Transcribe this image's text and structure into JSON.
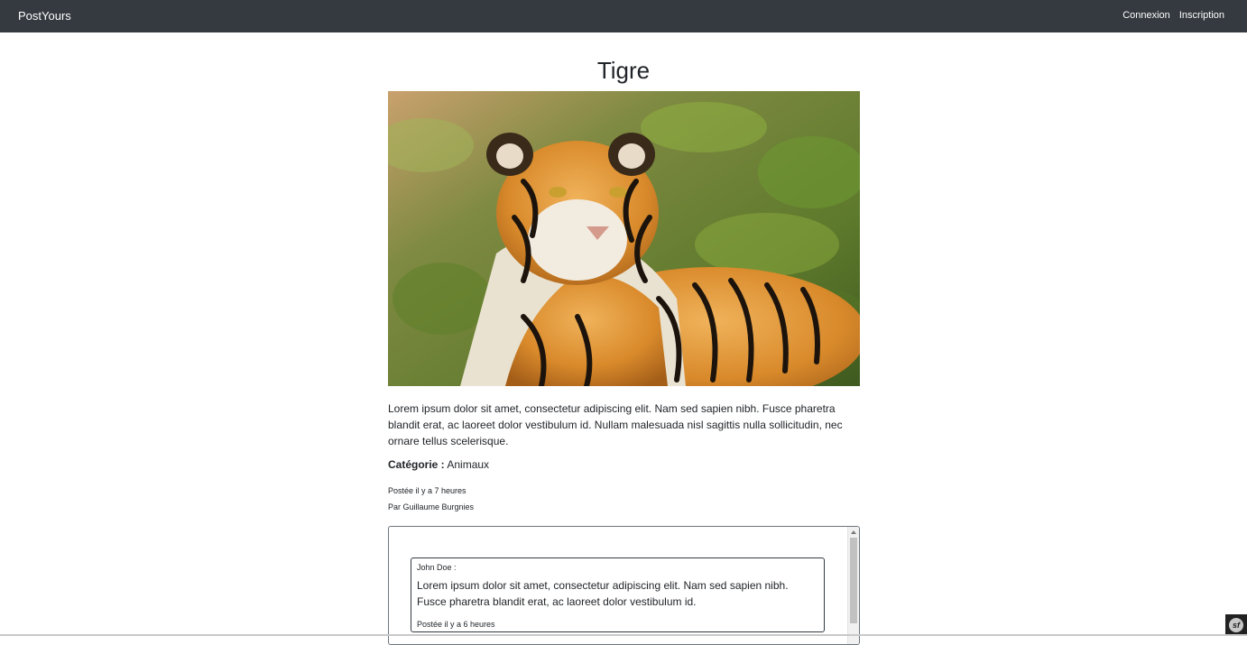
{
  "navbar": {
    "brand": "PostYours",
    "links": [
      "Connexion",
      "Inscription"
    ]
  },
  "post": {
    "title": "Tigre",
    "image_alt": "tiger-photo",
    "description": "Lorem ipsum dolor sit amet, consectetur adipiscing elit. Nam sed sapien nibh. Fusce pharetra blandit erat, ac laoreet dolor vestibulum id. Nullam malesuada nisl sagittis nulla sollicitudin, nec ornare tellus scelerisque.",
    "category_label": "Catégorie :",
    "category_value": "Animaux",
    "posted_time": "Postée il y a 7 heures",
    "author_line": "Par Guillaume Burgnies"
  },
  "comments": [
    {
      "author": "John Doe :",
      "text": "Lorem ipsum dolor sit amet, consectetur adipiscing elit. Nam sed sapien nibh. Fusce pharetra blandit erat, ac laoreet dolor vestibulum id.",
      "time": "Postée il y a 6 heures"
    }
  ],
  "toolbar": {
    "icon": "symfony-icon",
    "glyph": "sf"
  },
  "colors": {
    "navbar_bg": "#343a40",
    "text": "#212529",
    "border": "#6c757d"
  }
}
